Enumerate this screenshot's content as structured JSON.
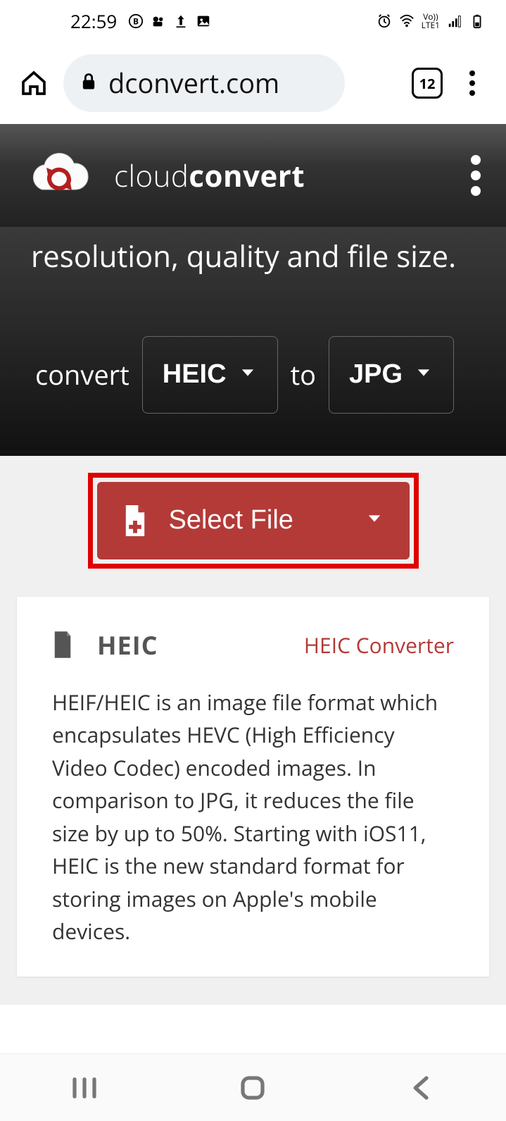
{
  "statusbar": {
    "time": "22:59",
    "network": "LTE1",
    "volte": "Vo))"
  },
  "browser": {
    "url_display": "dconvert.com",
    "tab_count": "12"
  },
  "site": {
    "brand_light": "cloud",
    "brand_bold": "convert"
  },
  "hero": {
    "tagline_fragment": "resolution, quality and file size.",
    "convert_label": "convert",
    "from_format": "HEIC",
    "to_label": "to",
    "to_format": "JPG"
  },
  "select": {
    "label": "Select File"
  },
  "format_card": {
    "format_name": "HEIC",
    "converter_link": "HEIC Converter",
    "description": "HEIF/HEIC is an image file format which encapsulates HEVC (High Efficiency Video Codec) encoded images. In comparison to JPG, it reduces the file size by up to 50%. Starting with iOS11, HEIC is the new standard format for storing images on Apple's mobile devices."
  }
}
